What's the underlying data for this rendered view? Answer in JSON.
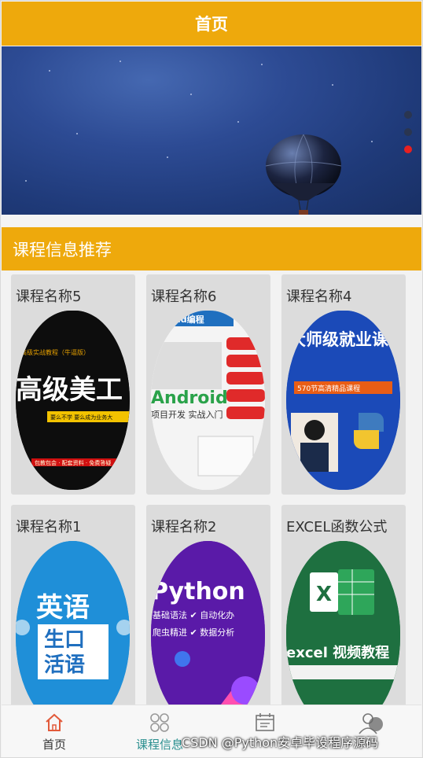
{
  "header": {
    "title": "首页"
  },
  "banner": {
    "dots": 3,
    "active_dot": 3
  },
  "section": {
    "title": "课程信息推荐"
  },
  "courses": [
    {
      "name": "课程名称5",
      "thumb_text": "高级美工",
      "thumb_sub": "要么不学 要么成为业务大"
    },
    {
      "name": "课程名称6",
      "thumb_text": "Android",
      "thumb_sub": "项目开发 实战入门"
    },
    {
      "name": "课程名称4",
      "thumb_text": "大师级就业课",
      "thumb_sub": "570节高清精品课程"
    },
    {
      "name": "课程名称1",
      "thumb_text": "英语",
      "thumb_sub": "生口 活语"
    },
    {
      "name": "课程名称2",
      "thumb_text": "Python",
      "thumb_sub": "基础语法 自动化办 爬虫精进 数据分析"
    },
    {
      "name": "EXCEL函数公式",
      "thumb_text": "X",
      "thumb_sub": "excel 视频教程"
    }
  ],
  "tabbar": {
    "items": [
      {
        "label": "首页",
        "icon": "home-icon"
      },
      {
        "label": "课程信息",
        "icon": "grid-icon"
      },
      {
        "label": "",
        "icon": "calendar-icon"
      },
      {
        "label": "",
        "icon": "user-icon"
      }
    ]
  },
  "watermark": "CSDN @Python安卓毕设程序源码",
  "colors": {
    "accent": "#eea90c",
    "banner": "#2d4b94",
    "active_dot": "#e82020"
  }
}
